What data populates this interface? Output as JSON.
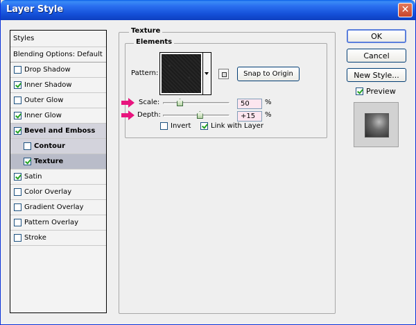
{
  "window": {
    "title": "Layer Style"
  },
  "styles_list": {
    "header": "Styles",
    "blending": "Blending Options: Default",
    "items": [
      {
        "label": "Drop Shadow",
        "checked": false
      },
      {
        "label": "Inner Shadow",
        "checked": true
      },
      {
        "label": "Outer Glow",
        "checked": false
      },
      {
        "label": "Inner Glow",
        "checked": true
      },
      {
        "label": "Bevel and Emboss",
        "checked": true
      },
      {
        "label": "Contour",
        "checked": false
      },
      {
        "label": "Texture",
        "checked": true
      },
      {
        "label": "Satin",
        "checked": true
      },
      {
        "label": "Color Overlay",
        "checked": false
      },
      {
        "label": "Gradient Overlay",
        "checked": false
      },
      {
        "label": "Pattern Overlay",
        "checked": false
      },
      {
        "label": "Stroke",
        "checked": false
      }
    ]
  },
  "texture": {
    "group_title": "Texture",
    "elements_title": "Elements",
    "pattern_label": "Pattern:",
    "snap_button": "Snap to Origin",
    "scale_label": "Scale:",
    "scale_value": "50",
    "scale_fraction": 0.25,
    "depth_label": "Depth:",
    "depth_value": "+15",
    "depth_fraction": 0.55,
    "percent": "%",
    "invert_label": "Invert",
    "invert_checked": false,
    "link_label": "Link with Layer",
    "link_checked": true
  },
  "actions": {
    "ok": "OK",
    "cancel": "Cancel",
    "new_style": "New Style...",
    "preview_label": "Preview",
    "preview_checked": true
  },
  "colors": {
    "arrow": "#e8157e",
    "title_bar": "#2a6ff0"
  }
}
